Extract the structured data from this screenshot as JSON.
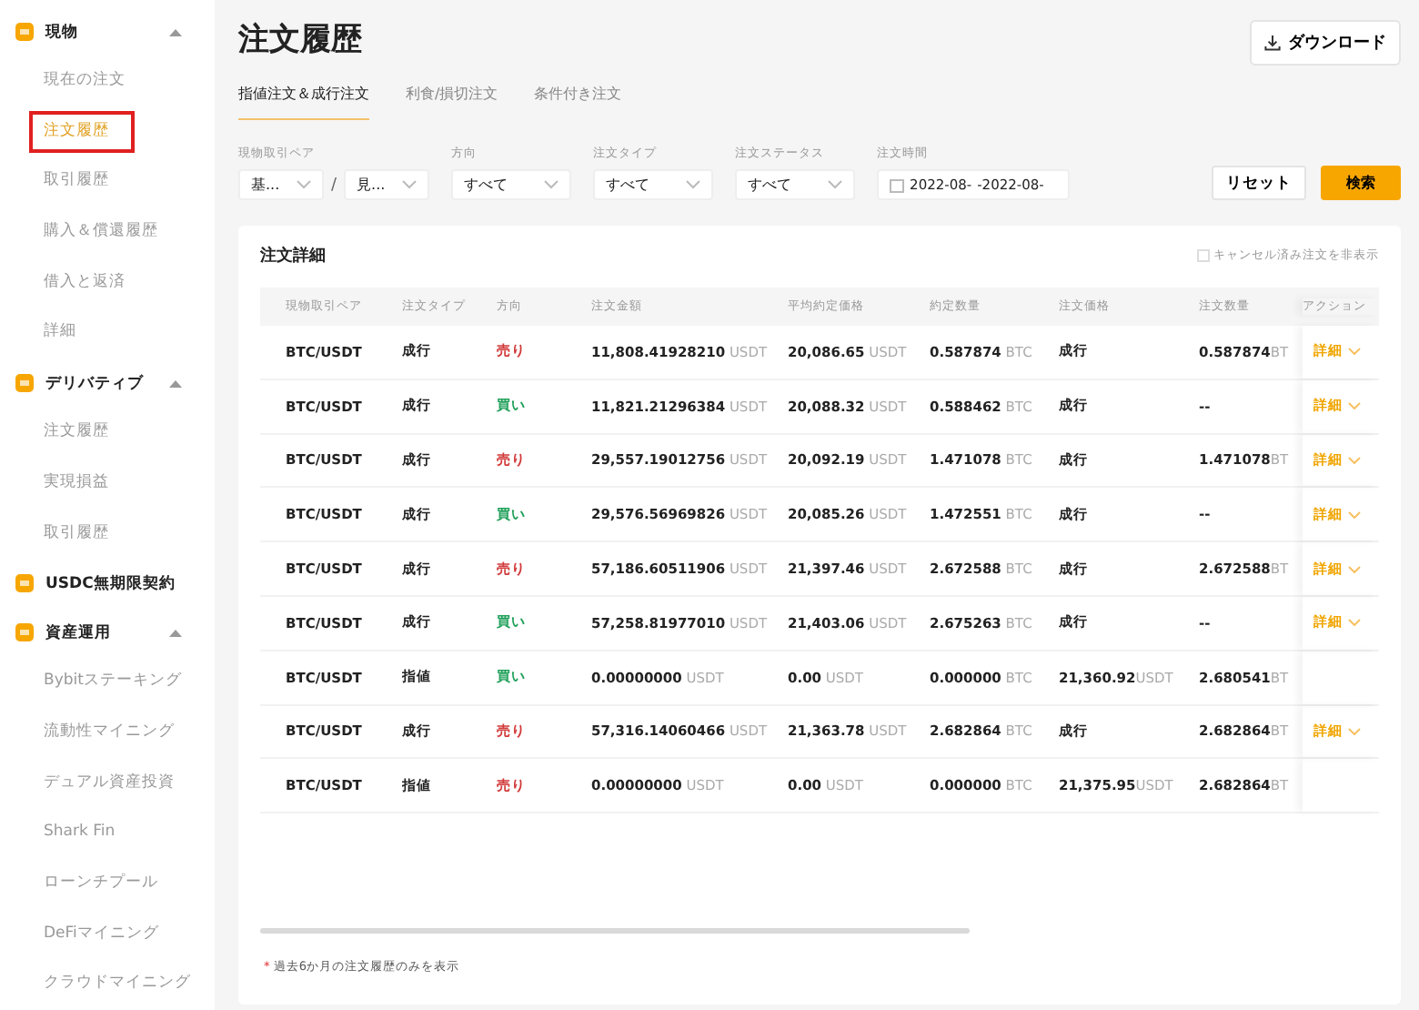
{
  "sidebar": {
    "sections": [
      {
        "title": "現物",
        "expanded": true,
        "items": [
          {
            "label": "現在の注文",
            "selected": false
          },
          {
            "label": "注文履歴",
            "selected": true
          },
          {
            "label": "取引履歴",
            "selected": false
          },
          {
            "label": "購入＆償還履歴",
            "selected": false
          },
          {
            "label": "借入と返済",
            "selected": false
          },
          {
            "label": "詳細",
            "selected": false
          }
        ]
      },
      {
        "title": "デリバティブ",
        "expanded": true,
        "items": [
          {
            "label": "注文履歴",
            "selected": false
          },
          {
            "label": "実現損益",
            "selected": false
          },
          {
            "label": "取引履歴",
            "selected": false
          }
        ]
      },
      {
        "title": "USDC無期限契約",
        "expanded": false
      },
      {
        "title": "資産運用",
        "expanded": true,
        "items": [
          {
            "label": "Bybitステーキング",
            "selected": false
          },
          {
            "label": "流動性マイニング",
            "selected": false
          },
          {
            "label": "デュアル資産投資",
            "selected": false
          },
          {
            "label": "Shark Fin",
            "selected": false
          },
          {
            "label": "ローンチプール",
            "selected": false
          },
          {
            "label": "DeFiマイニング",
            "selected": false
          },
          {
            "label": "クラウドマイニング",
            "selected": false
          }
        ]
      }
    ]
  },
  "page_title": "注文履歴",
  "download_button": "ダウンロード",
  "tabs": [
    {
      "label": "指値注文＆成行注文",
      "selected": true
    },
    {
      "label": "利食/損切注文",
      "selected": false
    },
    {
      "label": "条件付き注文",
      "selected": false
    }
  ],
  "filters": {
    "pair": {
      "label": "現物取引ペア",
      "base": "基...",
      "quote": "見...",
      "separator": "/"
    },
    "selects": [
      {
        "label": "方向",
        "value": "すべて"
      },
      {
        "label": "注文タイプ",
        "value": "すべて"
      },
      {
        "label": "注文ステータス",
        "value": "すべて"
      }
    ],
    "time": {
      "label": "注文時間",
      "start": "2022-08-",
      "end": "-2022-08-"
    },
    "reset_button": "リセット",
    "search_button": "検索"
  },
  "card": {
    "title": "注文詳細",
    "hide_cancelled": {
      "label": "キャンセル済み注文を非表示",
      "checked": false
    },
    "columns": [
      "現物取引ペア",
      "注文タイプ",
      "方向",
      "注文金額",
      "平均約定価格",
      "約定数量",
      "注文価格",
      "注文数量",
      "アクション"
    ],
    "rows": [
      {
        "pair": "BTC/USDT",
        "type": "成行",
        "side": {
          "text": "売り",
          "kind": "sell"
        },
        "amount": "11,808.41928210",
        "amount_unit": "USDT",
        "avg": "20,086.65",
        "avg_unit": "USDT",
        "filled": "0.587874",
        "filled_unit": "BTC",
        "price": "成行",
        "qty": "0.587874",
        "qty_unit": "BT",
        "action": "詳細"
      },
      {
        "pair": "BTC/USDT",
        "type": "成行",
        "side": {
          "text": "買い",
          "kind": "buy"
        },
        "amount": "11,821.21296384",
        "amount_unit": "USDT",
        "avg": "20,088.32",
        "avg_unit": "USDT",
        "filled": "0.588462",
        "filled_unit": "BTC",
        "price": "成行",
        "qty": "--",
        "action": "詳細"
      },
      {
        "pair": "BTC/USDT",
        "type": "成行",
        "side": {
          "text": "売り",
          "kind": "sell"
        },
        "amount": "29,557.19012756",
        "amount_unit": "USDT",
        "avg": "20,092.19",
        "avg_unit": "USDT",
        "filled": "1.471078",
        "filled_unit": "BTC",
        "price": "成行",
        "qty": "1.471078",
        "qty_unit": "BT",
        "action": "詳細"
      },
      {
        "pair": "BTC/USDT",
        "type": "成行",
        "side": {
          "text": "買い",
          "kind": "buy"
        },
        "amount": "29,576.56969826",
        "amount_unit": "USDT",
        "avg": "20,085.26",
        "avg_unit": "USDT",
        "filled": "1.472551",
        "filled_unit": "BTC",
        "price": "成行",
        "qty": "--",
        "action": "詳細"
      },
      {
        "pair": "BTC/USDT",
        "type": "成行",
        "side": {
          "text": "売り",
          "kind": "sell"
        },
        "amount": "57,186.60511906",
        "amount_unit": "USDT",
        "avg": "21,397.46",
        "avg_unit": "USDT",
        "filled": "2.672588",
        "filled_unit": "BTC",
        "price": "成行",
        "qty": "2.672588",
        "qty_unit": "BT",
        "action": "詳細"
      },
      {
        "pair": "BTC/USDT",
        "type": "成行",
        "side": {
          "text": "買い",
          "kind": "buy"
        },
        "amount": "57,258.81977010",
        "amount_unit": "USDT",
        "avg": "21,403.06",
        "avg_unit": "USDT",
        "filled": "2.675263",
        "filled_unit": "BTC",
        "price": "成行",
        "qty": "--",
        "action": "詳細"
      },
      {
        "pair": "BTC/USDT",
        "type": "指値",
        "side": {
          "text": "買い",
          "kind": "buy"
        },
        "amount": "0.00000000",
        "amount_unit": "USDT",
        "avg": "0.00",
        "avg_unit": "USDT",
        "filled": "0.000000",
        "filled_unit": "BTC",
        "price": "21,360.92",
        "price_unit": "USDT",
        "qty": "2.680541",
        "qty_unit": "BT"
      },
      {
        "pair": "BTC/USDT",
        "type": "成行",
        "side": {
          "text": "売り",
          "kind": "sell"
        },
        "amount": "57,316.14060466",
        "amount_unit": "USDT",
        "avg": "21,363.78",
        "avg_unit": "USDT",
        "filled": "2.682864",
        "filled_unit": "BTC",
        "price": "成行",
        "qty": "2.682864",
        "qty_unit": "BT",
        "action": "詳細"
      },
      {
        "pair": "BTC/USDT",
        "type": "指値",
        "side": {
          "text": "売り",
          "kind": "sell"
        },
        "amount": "0.00000000",
        "amount_unit": "USDT",
        "avg": "0.00",
        "avg_unit": "USDT",
        "filled": "0.000000",
        "filled_unit": "BTC",
        "price": "21,375.95",
        "price_unit": "USDT",
        "qty": "2.682864",
        "qty_unit": "BT"
      }
    ],
    "footnote_mark": "*",
    "footnote": "過去6か月の注文履歴のみを表示"
  }
}
